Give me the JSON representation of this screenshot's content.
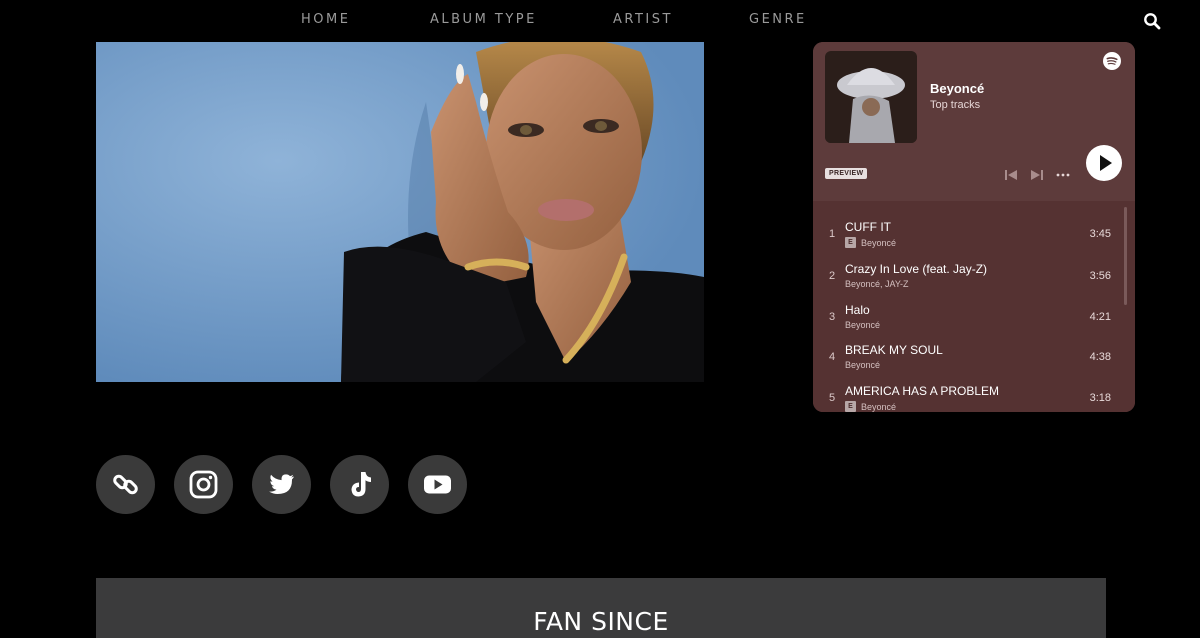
{
  "nav": {
    "links": [
      "HOME",
      "ALBUM TYPE",
      "ARTIST",
      "GENRE"
    ],
    "search_icon": "search-icon"
  },
  "hero": {
    "image": "portrait-photo"
  },
  "spotify": {
    "artist": "Beyoncé",
    "subtitle": "Top tracks",
    "preview_label": "PREVIEW",
    "logo_icon": "spotify-logo-icon",
    "colors": {
      "background": "#5d3b3b",
      "tracks_background": "#553232"
    },
    "tracks": [
      {
        "num": "1",
        "title": "CUFF IT",
        "artist": "Beyoncé",
        "explicit": true,
        "duration": "3:45"
      },
      {
        "num": "2",
        "title": "Crazy In Love (feat. Jay-Z)",
        "artist": "Beyoncé, JAY-Z",
        "explicit": false,
        "duration": "3:56"
      },
      {
        "num": "3",
        "title": "Halo",
        "artist": "Beyoncé",
        "explicit": false,
        "duration": "4:21"
      },
      {
        "num": "4",
        "title": "BREAK MY SOUL",
        "artist": "Beyoncé",
        "explicit": false,
        "duration": "4:38"
      },
      {
        "num": "5",
        "title": "AMERICA HAS A PROBLEM",
        "artist": "Beyoncé",
        "explicit": true,
        "duration": "3:18"
      }
    ],
    "explicit_badge": "E"
  },
  "social": {
    "icons": [
      "link-icon",
      "instagram-icon",
      "twitter-icon",
      "tiktok-icon",
      "youtube-icon"
    ]
  },
  "fan_section": {
    "title": "FAN SINCE"
  }
}
